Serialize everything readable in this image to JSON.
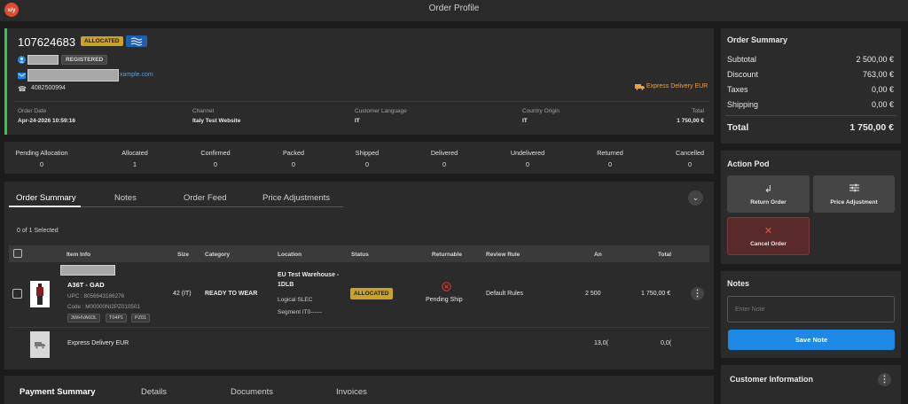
{
  "app": {
    "logo": "x/y",
    "title": "Order Profile"
  },
  "order": {
    "number": "107624683",
    "status_badge": "ALLOCATED",
    "flag_icon": "waves-flag-icon",
    "customer_tag": "REGISTERED",
    "email_suffix": "xample.com",
    "phone": "4082500994",
    "shipping_method": "Express Delivery EUR",
    "meta": [
      {
        "label": "Order Date",
        "value": "Apr-24-2026 10:59:16"
      },
      {
        "label": "Channel",
        "value": "Italy Test Website"
      },
      {
        "label": "Customer Language",
        "value": "IT"
      },
      {
        "label": "Country Origin",
        "value": "IT"
      },
      {
        "label": "Total",
        "value": "1 750,00 €"
      }
    ]
  },
  "status_counts": [
    {
      "label": "Pending Allocation",
      "value": "0"
    },
    {
      "label": "Allocated",
      "value": "1"
    },
    {
      "label": "Confirmed",
      "value": "0"
    },
    {
      "label": "Packed",
      "value": "0"
    },
    {
      "label": "Shipped",
      "value": "0"
    },
    {
      "label": "Delivered",
      "value": "0"
    },
    {
      "label": "Undelivered",
      "value": "0"
    },
    {
      "label": "Returned",
      "value": "0"
    },
    {
      "label": "Cancelled",
      "value": "0"
    }
  ],
  "tabs": [
    "Order Summary",
    "Notes",
    "Order Feed",
    "Price Adjustments"
  ],
  "selection_text": "0 of 1 Selected",
  "table": {
    "headers": [
      "Item Info",
      "Size",
      "Category",
      "Location",
      "Status",
      "Returnable",
      "Review Rule",
      "An",
      "Total"
    ],
    "item": {
      "name": "A36T - GAD",
      "upc": "UPC : 8056643186276",
      "code": "Code : M00000NI2PZ010501",
      "chips": [
        "3WHVA6DL",
        "T04P1",
        "PZ01"
      ],
      "size": "42 (IT)",
      "category": "READY TO WEAR",
      "location_line1": "EU Test Warehouse -",
      "location_line2": "1DLB",
      "location_sub1": "Logical SLEC",
      "location_sub2": "Segment IT0------",
      "status": "ALLOCATED",
      "returnable": "Pending Ship",
      "review_rule": "Default Rules",
      "amount": "2 500",
      "total": "1 750,00 €"
    },
    "shipping_row": {
      "name": "Express Delivery EUR",
      "amount": "13,0(",
      "total": "0,0("
    }
  },
  "bottom_tabs": [
    "Payment Summary",
    "Details",
    "Documents",
    "Invoices"
  ],
  "summary": {
    "title": "Order Summary",
    "rows": [
      {
        "label": "Subtotal",
        "value": "2 500,00 €"
      },
      {
        "label": "Discount",
        "value": "763,00 €"
      },
      {
        "label": "Taxes",
        "value": "0,00 €"
      },
      {
        "label": "Shipping",
        "value": "0,00 €"
      }
    ],
    "total_label": "Total",
    "total_value": "1 750,00 €"
  },
  "action_pod": {
    "title": "Action Pod",
    "return": "Return Order",
    "price": "Price Adjustment",
    "cancel": "Cancel Order"
  },
  "notes": {
    "title": "Notes",
    "placeholder": "Enter Note",
    "save": "Save Note"
  },
  "customer_info": {
    "title": "Customer Information"
  },
  "colors": {
    "accent_blue": "#1e88e5",
    "allocated": "#c9a227",
    "green_bar": "#2ecc40",
    "cancel_bg": "#5a2a2a",
    "shipping_orange": "#e8a24a"
  }
}
